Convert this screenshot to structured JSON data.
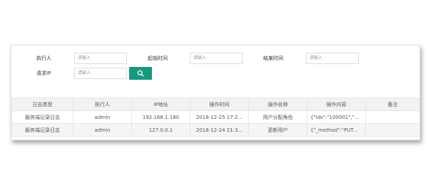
{
  "filters": {
    "executor_label": "执行人",
    "executor_placeholder": "请输入",
    "start_time_label": "起始时间",
    "start_time_placeholder": "请输入",
    "end_time_label": "结束时间",
    "end_time_placeholder": "请输入",
    "request_ip_label": "请求IP",
    "request_ip_placeholder": "请输入",
    "search_icon": "search-icon",
    "search_button_color": "#16987e"
  },
  "table": {
    "headers": [
      "日志类型",
      "执行人",
      "IP地址",
      "操作时间",
      "操作名称",
      "操作内容",
      "备注"
    ],
    "rows": [
      [
        "服务端记录日志",
        "admin",
        "192.168.1.180",
        "2018-12-25 17:2...",
        "用户分配角色",
        "{\"ids\":\"100001\",\"...",
        ""
      ],
      [
        "服务端记录日志",
        "admin",
        "127.0.0.1",
        "2018-12-24 21:3...",
        "更新用户",
        "{\"_method\":\"PUT...",
        ""
      ]
    ]
  }
}
